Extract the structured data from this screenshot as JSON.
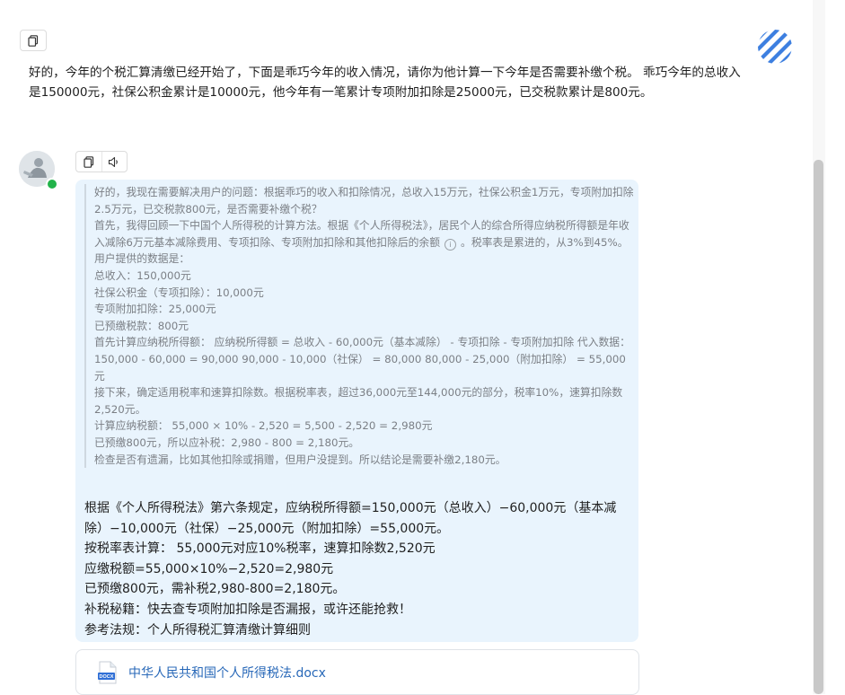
{
  "user_message": {
    "text": "好的，今年的个税汇算清缴已经开始了，下面是乖巧今年的收入情况，请你为他计算一下今年是否需要补缴个税。 乖巧今年的总收入是150000元，社保公积金累计是10000元，他今年有一笔累计专项附加扣除是25000元，已交税款累计是800元。"
  },
  "assistant": {
    "thinking": {
      "p1": "好的，我现在需要解决用户的问题：根据乖巧的收入和扣除情况，总收入15万元，社保公积金1万元，专项附加扣除2.5万元，已交税款800元，是否需要补缴个税？",
      "p2a": "首先，我得回顾一下中国个人所得税的计算方法。根据《个人所得税法》，居民个人的综合所得应纳税所得额是年收入减除6万元基本减除费用、专项扣除、专项附加扣除和其他扣除后的余额",
      "p2b": "。税率表是累进的，从3%到45%。",
      "p3": "用户提供的数据是：",
      "p4": "总收入：150,000元",
      "p5": "社保公积金（专项扣除）：10,000元",
      "p6": "专项附加扣除：25,000元",
      "p7": "已预缴税款：800元",
      "p8": "首先计算应纳税所得额： 应纳税所得额 = 总收入 - 60,000元（基本减除） - 专项扣除 - 专项附加扣除 代入数据： 150,000 - 60,000 = 90,000 90,000 - 10,000（社保） = 80,000 80,000 - 25,000（附加扣除） = 55,000元",
      "p9": "接下来，确定适用税率和速算扣除数。根据税率表，超过36,000元至144,000元的部分，税率10%，速算扣除数2,520元。",
      "p10": "计算应纳税额： 55,000 × 10% - 2,520 = 5,500 - 2,520 = 2,980元",
      "p11": "已预缴800元，所以应补税：2,980 - 800 = 2,180元。",
      "p12": "检查是否有遗漏，比如其他扣除或捐赠，但用户没提到。所以结论是需要补缴2,180元。"
    },
    "final": {
      "l1": "根据《个人所得税法》第六条规定，应纳税所得额=150,000元（总收入）−60,000元（基本减除）−10,000元（社保）−25,000元（附加扣除）=55,000元。",
      "l2": "按税率表计算： 55,000元对应10%税率，速算扣除数2,520元",
      "l3": "应缴税额=55,000×10%−2,520=2,980元",
      "l4": "已预缴800元，需补税2,980-800=2,180元。",
      "l5": "补税秘籍：快去查专项附加扣除是否漏报，或许还能抢救！",
      "l6": "参考法规：个人所得税汇算清缴计算细则"
    },
    "attachment": {
      "file_name": "中华人民共和国个人所得税法.docx",
      "file_type": "DOCX"
    }
  },
  "icons": {
    "copy": "copy-icon",
    "speaker": "speaker-icon",
    "cite": "info-circle-icon",
    "brand": "striped-circle-logo",
    "file": "docx-file-icon"
  },
  "colors": {
    "bubble_bg": "#e9f4fd",
    "link_blue": "#2868b8",
    "logo_blue": "#3d7fe0",
    "online_green": "#22b34a"
  }
}
